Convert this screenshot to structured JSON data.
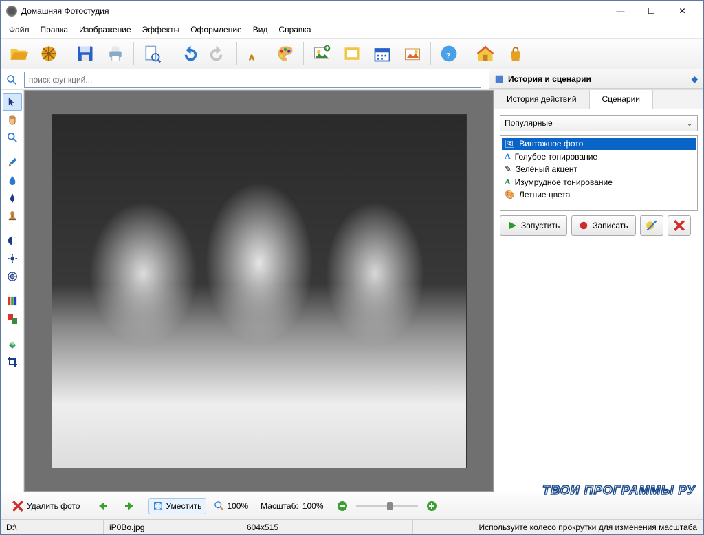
{
  "titlebar": {
    "title": "Домашняя Фотостудия"
  },
  "menu": [
    "Файл",
    "Правка",
    "Изображение",
    "Эффекты",
    "Оформление",
    "Вид",
    "Справка"
  ],
  "search": {
    "placeholder": "поиск функций..."
  },
  "rightpanel": {
    "title": "История и сценарии",
    "tabs": [
      "История действий",
      "Сценарии"
    ],
    "active_tab": 1,
    "combo": "Популярные",
    "items": [
      {
        "label": "Винтажное фото",
        "selected": true,
        "icon": "folder"
      },
      {
        "label": "Голубое тонирование",
        "selected": false,
        "icon": "letter-a-blue"
      },
      {
        "label": "Зелёный акцент",
        "selected": false,
        "icon": "pencil-green"
      },
      {
        "label": "Изумрудное тонирование",
        "selected": false,
        "icon": "letter-a-green"
      },
      {
        "label": "Летние цвета",
        "selected": false,
        "icon": "palette"
      }
    ],
    "run": "Запустить",
    "record": "Записать"
  },
  "bottom": {
    "delete": "Удалить фото",
    "fit": "Уместить",
    "hundred": "100%",
    "scale_label": "Масштаб:",
    "scale_value": "100%"
  },
  "status": {
    "drive": "D:\\",
    "file": "iP0Bo.jpg",
    "dims": "604x515",
    "hint": "Используйте колесо прокрутки для изменения масштаба"
  },
  "watermark": "ТВОИ ПРОГРАММЫ РУ",
  "icons": {
    "folder": "📂",
    "gear": "⚙",
    "save": "💾",
    "print": "🖨",
    "undo": "↶",
    "redo": "↷",
    "text": "A",
    "palette": "🎨",
    "image": "🖼",
    "help": "?",
    "home": "🏠",
    "lock": "🔒"
  }
}
